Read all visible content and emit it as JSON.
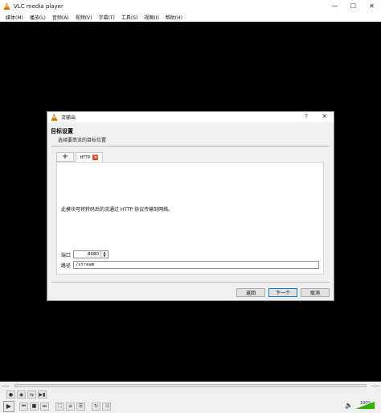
{
  "window": {
    "title": "VLC media player",
    "controls": {
      "minimize": "—",
      "maximize": "☐",
      "close": "✕"
    }
  },
  "menu": [
    "媒体(M)",
    "播放(L)",
    "音频(A)",
    "视频(V)",
    "字幕(T)",
    "工具(S)",
    "视图(I)",
    "帮助(H)"
  ],
  "player": {
    "time_elapsed": "--:--",
    "time_total": "--:--",
    "volume_percent": "100%",
    "volume_level": 1.0
  },
  "dialog": {
    "title": "流输出",
    "help": "?",
    "close": "✕",
    "header_title": "目标设置",
    "header_subtitle": "选择要串流的目标位置",
    "tab_add": "+",
    "tab_label": "HTTP",
    "tab_close": "×",
    "description": "此模块可将转码后的流通过 HTTP 协议传输到网络。",
    "port_label": "端口",
    "port_value": "8080",
    "path_label": "路径",
    "path_value": "/stream",
    "back_button": "返回",
    "next_button": "下一个",
    "cancel_button": "取消"
  },
  "colors": {
    "video_bg": "#000000",
    "vlc_orange": "#f08a00",
    "tab_close_red": "#e0442b",
    "volume_green": "#2db400"
  }
}
